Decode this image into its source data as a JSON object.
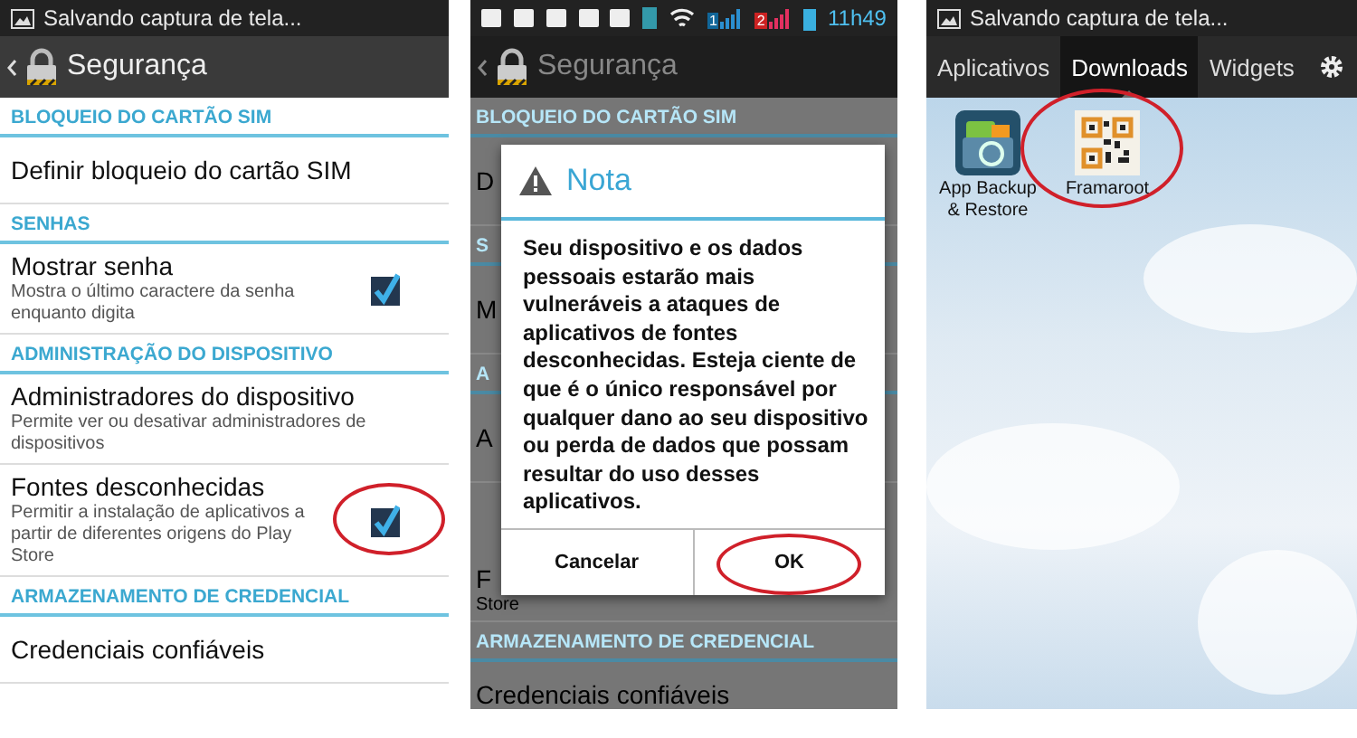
{
  "panels": [
    {
      "kind": "settings",
      "status_title": "Salvando captura de tela...",
      "title": "Segurança",
      "items": [
        {
          "kind": "section",
          "label": "BLOQUEIO DO CARTÃO SIM"
        },
        {
          "kind": "item",
          "title": "Definir bloqueio do cartão SIM"
        },
        {
          "kind": "section",
          "label": "SENHAS"
        },
        {
          "kind": "check",
          "title": "Mostrar senha",
          "summary": "Mostra o último caractere da senha enquanto digita",
          "checked": true,
          "highlighted": false
        },
        {
          "kind": "section",
          "label": "ADMINISTRAÇÃO DO DISPOSITIVO"
        },
        {
          "kind": "item",
          "title": "Administradores do dispositivo",
          "summary": "Permite ver ou desativar administradores de dispositivos"
        },
        {
          "kind": "check",
          "title": "Fontes desconhecidas",
          "summary": "Permitir a instalação de aplicativos a partir de diferentes origens do Play Store",
          "checked": true,
          "highlighted": true
        },
        {
          "kind": "section",
          "label": "ARMAZENAMENTO DE CREDENCIAL"
        },
        {
          "kind": "item",
          "title": "Credenciais confiáveis"
        }
      ]
    },
    {
      "kind": "dialog",
      "status_time": "11h49",
      "sim_labels": [
        "1",
        "2"
      ],
      "title": "Segurança",
      "items": [
        {
          "kind": "section",
          "label": "BLOQUEIO DO CARTÃO SIM"
        },
        {
          "kind": "item",
          "title": "D"
        },
        {
          "kind": "section",
          "label": "S"
        },
        {
          "kind": "item",
          "title": "M"
        },
        {
          "kind": "section",
          "label": "A"
        },
        {
          "kind": "item",
          "title": "A"
        },
        {
          "kind": "item",
          "title": "F",
          "summary": "Store"
        },
        {
          "kind": "section",
          "label": "ARMAZENAMENTO DE CREDENCIAL"
        },
        {
          "kind": "item",
          "title": "Credenciais confiáveis"
        }
      ],
      "dialog": {
        "title": "Nota",
        "message": "Seu dispositivo e os dados pessoais estarão mais vulneráveis a ataques de aplicativos de fontes desconhecidas. Esteja ciente de que é o único responsável por qualquer dano ao seu dispositivo ou perda de dados que possam resultar do uso desses aplicativos.",
        "buttons": [
          {
            "label": "Cancelar",
            "highlighted": false
          },
          {
            "label": "OK",
            "highlighted": true
          }
        ]
      }
    },
    {
      "kind": "launcher",
      "status_title": "Salvando captura de tela...",
      "tabs": [
        {
          "label": "Aplicativos",
          "selected": false
        },
        {
          "label": "Downloads",
          "selected": true
        },
        {
          "label": "Widgets",
          "selected": false
        }
      ],
      "apps": [
        {
          "kind": "backup",
          "label": "App Backup & Restore",
          "highlighted": false
        },
        {
          "kind": "qr",
          "label": "Framaroot",
          "highlighted": true
        }
      ]
    }
  ]
}
